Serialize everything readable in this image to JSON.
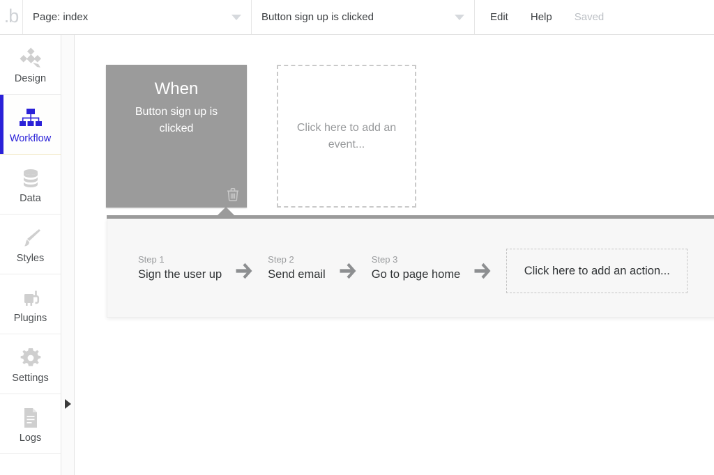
{
  "app": {
    "logo": ".b",
    "logo_icon": "bubble-logo-icon"
  },
  "topbar": {
    "page_dropdown": {
      "label": "Page: index",
      "icon": "chevron-down-icon"
    },
    "event_dropdown": {
      "label": "Button sign up is clicked",
      "icon": "chevron-down-icon"
    },
    "menu": [
      {
        "label": "Edit"
      },
      {
        "label": "Help"
      },
      {
        "label": "Saved"
      }
    ]
  },
  "sidebar": {
    "items": [
      {
        "label": "Design",
        "icon": "design-icon",
        "active": false
      },
      {
        "label": "Workflow",
        "icon": "workflow-icon",
        "active": true
      },
      {
        "label": "Data",
        "icon": "database-icon",
        "active": false
      },
      {
        "label": "Styles",
        "icon": "brush-icon",
        "active": false
      },
      {
        "label": "Plugins",
        "icon": "plug-icon",
        "active": false
      },
      {
        "label": "Settings",
        "icon": "gear-icon",
        "active": false
      },
      {
        "label": "Logs",
        "icon": "document-icon",
        "active": false
      }
    ],
    "collapse_handle_icon": "triangle-right-icon"
  },
  "canvas": {
    "event": {
      "title": "When",
      "subtitle": "Button sign up is clicked",
      "delete_icon": "trash-icon"
    },
    "add_event_placeholder": "Click here to add an event...",
    "steps": [
      {
        "number": "Step 1",
        "name": "Sign the user up"
      },
      {
        "number": "Step 2",
        "name": "Send email"
      },
      {
        "number": "Step 3",
        "name": "Go to page home"
      }
    ],
    "add_action_placeholder": "Click here to add an action...",
    "arrow_icon": "arrow-right-icon"
  },
  "colors": {
    "accent_blue": "#2a21d8",
    "event_gray": "#9b9b9b",
    "panel_bg": "#f7f7f7",
    "text_dark": "#2f3234",
    "text_muted": "#9a9c9e"
  }
}
